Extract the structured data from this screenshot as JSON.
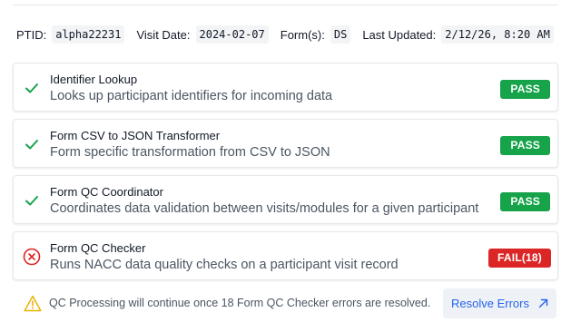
{
  "visit": {
    "ptid_label": "PTID:",
    "ptid_value": "alpha22231",
    "date_label": "Visit Date:",
    "date_value": "2024-02-07",
    "forms_label": "Form(s):",
    "forms_value": "DS",
    "updated_label": "Last Updated:",
    "updated_value": "2/12/26, 8:20 AM"
  },
  "checks": [
    {
      "title": "Identifier Lookup",
      "description": "Looks up participant identifiers for incoming data",
      "status": "PASS",
      "icon": "check-icon"
    },
    {
      "title": "Form CSV to JSON Transformer",
      "description": "Form specific transformation from CSV to JSON",
      "status": "PASS",
      "icon": "check-icon"
    },
    {
      "title": "Form QC Coordinator",
      "description": "Coordinates data validation between visits/modules for a given participant",
      "status": "PASS",
      "icon": "check-icon"
    },
    {
      "title": "Form QC Checker",
      "description": "Runs NACC data quality checks on a participant visit record",
      "status": "FAIL(18)",
      "icon": "error-circle-icon"
    }
  ],
  "alert": {
    "icon": "warning-triangle-icon",
    "message": "QC Processing will continue once 18 Form QC Checker errors are resolved.",
    "button_label": "Resolve Errors",
    "button_icon": "external-arrow-icon"
  },
  "colors": {
    "pass": "#16a34a",
    "fail": "#dc2626",
    "warning": "#eab308",
    "link": "#2563eb"
  }
}
